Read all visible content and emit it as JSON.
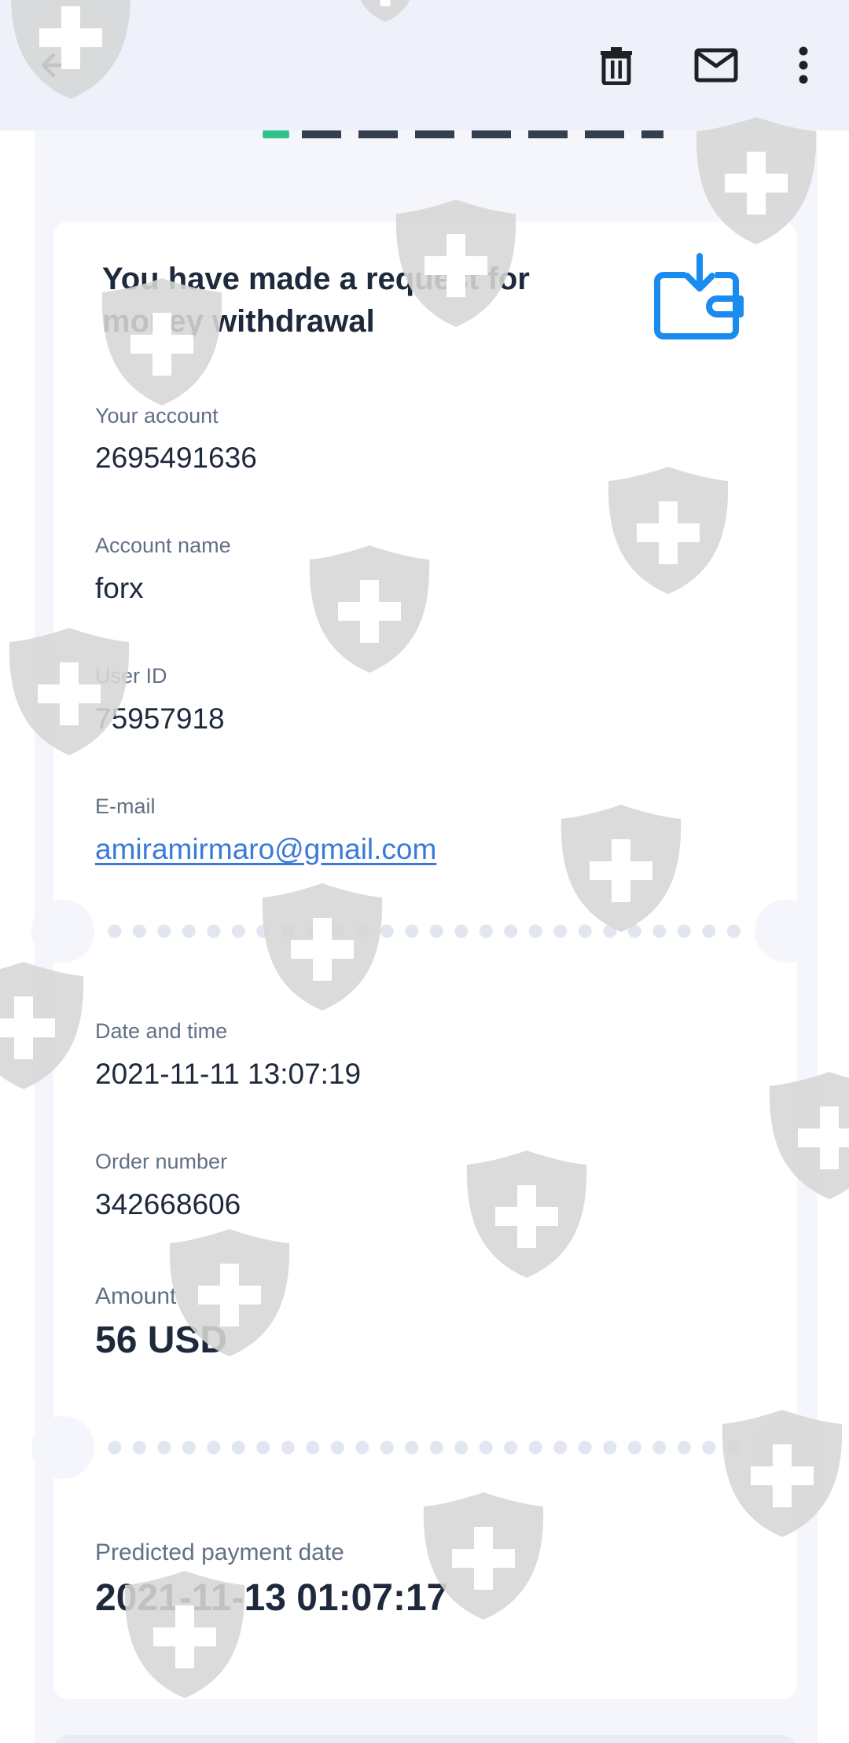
{
  "toolbar": {
    "back_icon": "arrow-left-icon",
    "delete_icon": "trash-icon",
    "mail_icon": "envelope-icon",
    "more_icon": "more-vertical-icon"
  },
  "email": {
    "title": "You have made a request for money withdrawal",
    "icon": "wallet-download-icon",
    "fields": [
      {
        "label": "Your account",
        "value": "2695491636"
      },
      {
        "label": "Account name",
        "value": "forx"
      },
      {
        "label": "User ID",
        "value": "75957918"
      },
      {
        "label": "E-mail",
        "value": "amiramirmaro@gmail.com"
      }
    ],
    "date_label": "Date and time",
    "date_value": "2021-11-11 13:07:19",
    "order_label": "Order number",
    "order_value": "342668606",
    "amount_label": "Amount",
    "amount_value": "56 USD",
    "predicted_label": "Predicted payment date",
    "predicted_value": "2021-11-13 01:07:17"
  },
  "colors": {
    "accent": "#1a8cf0",
    "link": "#3b7ad9",
    "text": "#1e2a3b",
    "label": "#627085",
    "background": "#eef1f9",
    "watermark": "#d4d4d4"
  },
  "watermark": {
    "icon": "shield-plus-icon"
  }
}
